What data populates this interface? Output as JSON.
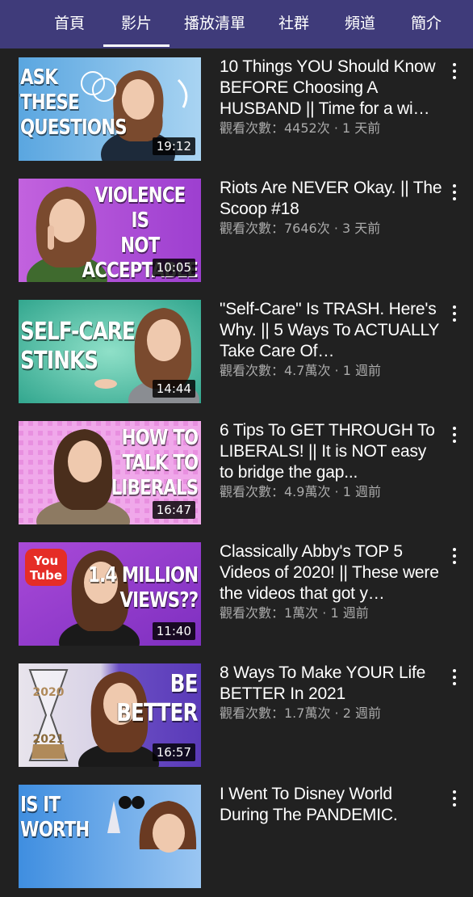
{
  "tabs": [
    {
      "label": "首頁",
      "active": false
    },
    {
      "label": "影片",
      "active": true
    },
    {
      "label": "播放清單",
      "active": false
    },
    {
      "label": "社群",
      "active": false
    },
    {
      "label": "頻道",
      "active": false
    },
    {
      "label": "簡介",
      "active": false
    }
  ],
  "videos": [
    {
      "title": "10 Things YOU Should Know BEFORE Choosing A HUSBAND || Time for a wi…",
      "views": "觀看次數：4452次",
      "age": "1 天前",
      "duration": "19:12",
      "thumb_text": "ASK\nTHESE\nQUESTIONS",
      "thumb_colors": [
        "#5aa6e0",
        "#a9d4f2"
      ]
    },
    {
      "title": "Riots Are NEVER Okay. || The Scoop #18",
      "views": "觀看次數：7646次",
      "age": "3 天前",
      "duration": "10:05",
      "thumb_text": "VIOLENCE\nIS\nNOT\nACCEPTABLE",
      "thumb_colors": [
        "#b04ad0",
        "#d98cf0"
      ]
    },
    {
      "title": "\"Self-Care\" Is TRASH. Here's Why. || 5 Ways To ACTUALLY Take Care Of…",
      "views": "觀看次數：4.7萬次",
      "age": "1 週前",
      "duration": "14:44",
      "thumb_text": "SELF-CARE\nSTINKS",
      "thumb_colors": [
        "#3fb8a0",
        "#8fe0c8"
      ]
    },
    {
      "title": "6 Tips To GET THROUGH To LIBERALS! || It is NOT easy to bridge the gap...",
      "views": "觀看次數：4.9萬次",
      "age": "1 週前",
      "duration": "16:47",
      "thumb_text": "HOW TO\nTALK TO\nLIBERALS",
      "thumb_colors": [
        "#e27ad6",
        "#f7b3ef"
      ]
    },
    {
      "title": "Classically Abby's TOP 5 Videos of 2020! || These were the videos that got y…",
      "views": "觀看次數：1萬次",
      "age": "1 週前",
      "duration": "11:40",
      "thumb_text": "1.4 MILLION\nVIEWS??",
      "thumb_colors": [
        "#9c3fd2",
        "#c57ef0"
      ]
    },
    {
      "title": "8 Ways To Make YOUR Life BETTER In 2021",
      "views": "觀看次數：1.7萬次",
      "age": "2 週前",
      "duration": "16:57",
      "thumb_text": "BE\nBETTER",
      "thumb_colors": [
        "#6a4ec4",
        "#e6e2ec"
      ]
    },
    {
      "title": "I Went To Disney World During The PANDEMIC.",
      "views": "",
      "age": "",
      "duration": "",
      "thumb_text": "IS IT\nWORTH",
      "thumb_colors": [
        "#3f8ee0",
        "#9ac6f2"
      ]
    }
  ],
  "icons": {
    "more": "more-vert-icon",
    "youtube_logo": "youtube-logo-icon",
    "hourglass": "hourglass-icon"
  },
  "logo_text": {
    "you": "You",
    "tube": "Tube"
  },
  "hourglass_years": {
    "top": "2020",
    "bottom": "2021"
  }
}
